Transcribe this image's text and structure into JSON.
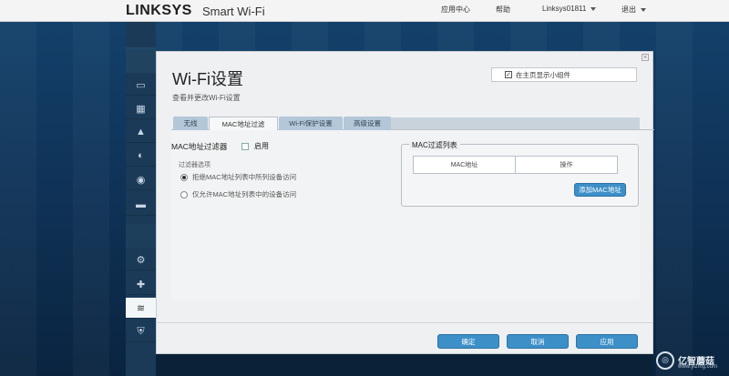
{
  "brand": {
    "logo": "LINKSYS",
    "product": "Smart Wi-Fi"
  },
  "topnav": {
    "app_center": "应用中心",
    "help": "帮助",
    "user": "Linksys01811",
    "logout": "退出"
  },
  "sidebar": {
    "items": [
      {
        "icon": "network-map-icon"
      },
      {
        "icon": "device-list-icon"
      },
      {
        "icon": "alert-icon"
      },
      {
        "icon": "parental-controls-icon"
      },
      {
        "icon": "speed-test-icon"
      },
      {
        "icon": "usb-storage-icon"
      },
      {
        "icon": "connectivity-gears-icon"
      },
      {
        "icon": "troubleshooting-icon"
      },
      {
        "icon": "wifi-settings-icon"
      },
      {
        "icon": "security-icon"
      }
    ]
  },
  "panel": {
    "title": "Wi-Fi设置",
    "subtitle": "查看并更改Wi-Fi设置",
    "show_widget_label": "在主页显示小组件",
    "show_widget_checked": true,
    "close_glyph": "×"
  },
  "tabs": [
    {
      "label": "无线",
      "active": false
    },
    {
      "label": "MAC地址过滤",
      "active": true
    },
    {
      "label": "Wi-Fi保护设置",
      "active": false
    },
    {
      "label": "高级设置",
      "active": false
    }
  ],
  "mac_filter": {
    "section_title": "MAC地址过滤器",
    "enable_label": "启用",
    "enabled": false,
    "options_label": "过滤器选项",
    "options": [
      {
        "label": "拒绝MAC地址列表中所列设备访问",
        "selected": true
      },
      {
        "label": "仅允许MAC地址列表中的设备访问",
        "selected": false
      }
    ]
  },
  "mac_list": {
    "title": "MAC过滤列表",
    "columns": [
      "MAC地址",
      "操作"
    ],
    "add_button": "添加MAC地址"
  },
  "footer": {
    "ok": "确定",
    "cancel": "取消",
    "apply": "应用"
  },
  "watermark": {
    "text": "亿智蘑菇",
    "sub": "www.yizmg.com"
  },
  "colors": {
    "accent": "#3d8fc7",
    "sidebar": "#1b3a57",
    "background": "#13406a"
  }
}
